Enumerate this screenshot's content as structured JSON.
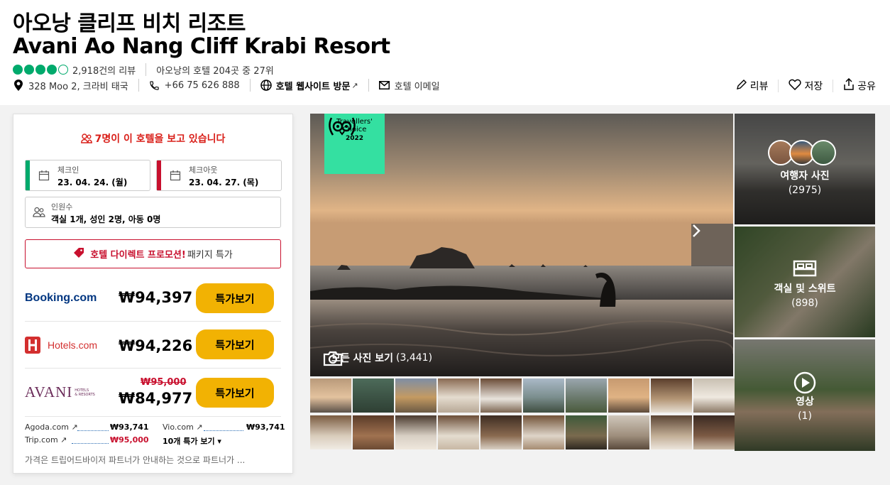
{
  "hotel": {
    "name_ko": "아오낭 클리프 비치 리조트",
    "name_en": "Avani Ao Nang Cliff Krabi Resort",
    "rating_bubbles": 4,
    "rating_max": 5,
    "reviews": "2,918건의 리뷰",
    "ranking": "아오낭의 호텔 204곳 중 27위",
    "address": "328 Moo 2, 크라비 태국",
    "phone": "+66 75 626 888",
    "website": "호텔 웹사이트 방문",
    "email": "호텔 이메일"
  },
  "actions": {
    "review": "리뷰",
    "save": "저장",
    "share": "공유"
  },
  "booking": {
    "viewing": "7명이 이 호텔을 보고 있습니다",
    "checkin_label": "체크인",
    "checkin_value": "23. 04. 24. (월)",
    "checkout_label": "체크아웃",
    "checkout_value": "23. 04. 27. (목)",
    "guests_label": "인원수",
    "guests_value": "객실 1개, 성인 2명, 아동 0명",
    "promo_red": "호텔 다이렉트 프로모션!",
    "promo_grey": "패키지 특가",
    "offers": [
      {
        "provider": "Booking.com",
        "price": "₩94,397",
        "old_price": "",
        "button": "특가보기"
      },
      {
        "provider": "Hotels.com",
        "price": "₩94,226",
        "old_price": "",
        "button": "특가보기"
      },
      {
        "provider": "AVANI",
        "price": "₩84,977",
        "old_price": "₩95,000",
        "button": "특가보기"
      }
    ],
    "others": [
      {
        "name": "Agoda.com",
        "price": "₩93,741"
      },
      {
        "name": "Vio.com",
        "price": "₩93,741"
      },
      {
        "name": "Trip.com",
        "price": "₩95,000"
      }
    ],
    "more_deals": "10개 특가 보기",
    "disclaimer": "가격은 트립어드바이저 파트너가 안내하는 것으로 파트너가 ..."
  },
  "gallery": {
    "badge_line1": "Travellers'",
    "badge_line2": "Choice",
    "badge_year": "2022",
    "all_photos": "모든 사진 보기",
    "all_photos_count": "(3,441)",
    "traveller_photos": "여행자 사진",
    "traveller_photos_count": "(2975)",
    "rooms": "객실 및 스위트",
    "rooms_count": "(898)",
    "video": "영상",
    "video_count": "(1)"
  },
  "colors": {
    "brand_green": "#00aa6c",
    "badge_green": "#34e0a1",
    "deal_yellow": "#f2b203",
    "alert_red": "#c8102e"
  }
}
